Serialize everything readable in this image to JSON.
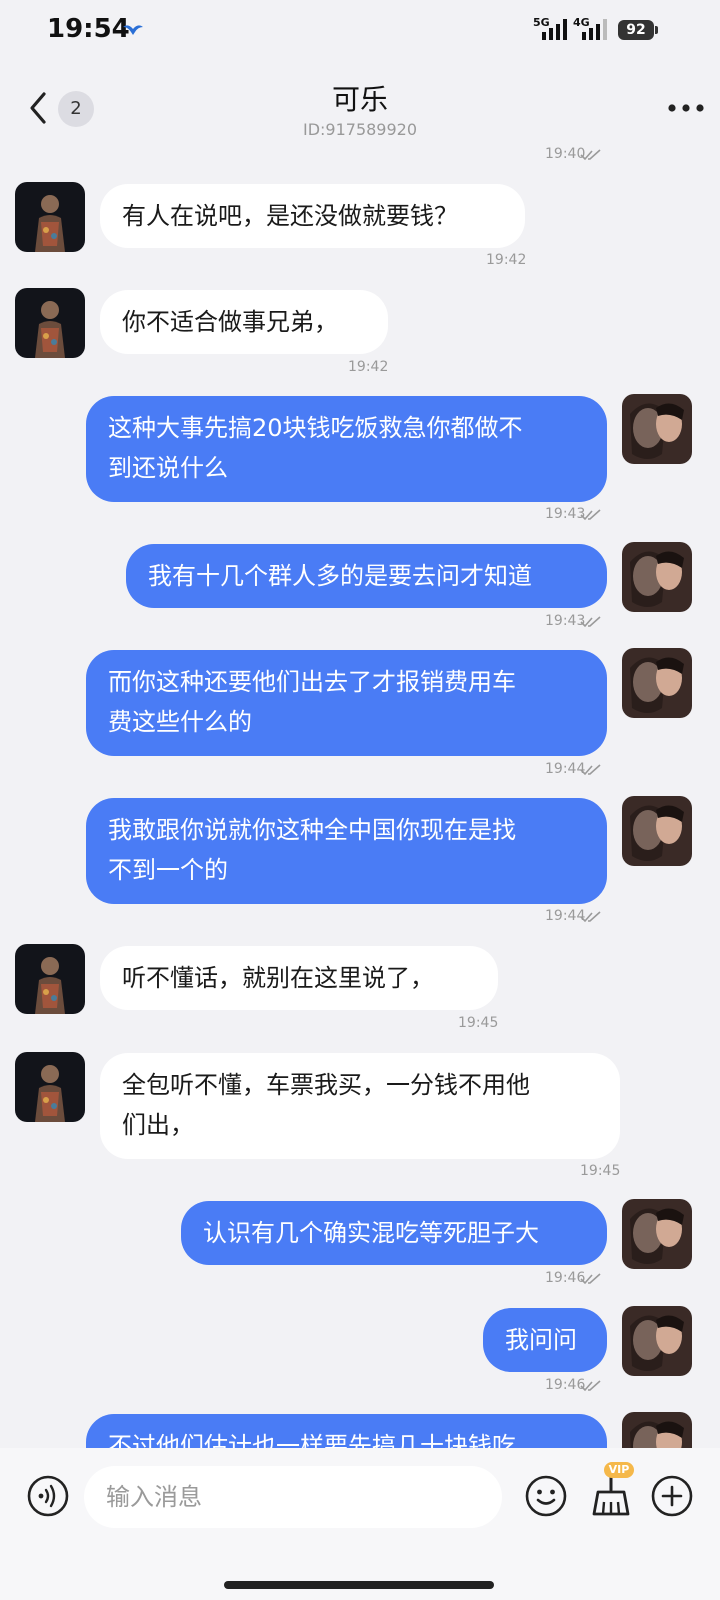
{
  "status_bar": {
    "time": "19:54",
    "network_1": "5G",
    "network_2": "4G",
    "battery": "92"
  },
  "header": {
    "title": "可乐",
    "subtitle": "ID:917589920",
    "unread_count": "2"
  },
  "messages": [
    {
      "side": "out",
      "lines": [],
      "time": "19:40",
      "read": true
    },
    {
      "side": "in",
      "lines": [
        "有人在说吧，是还没做就要钱？"
      ],
      "time": "19:42",
      "read": false
    },
    {
      "side": "in",
      "lines": [
        "你不适合做事兄弟，"
      ],
      "time": "19:42",
      "read": false
    },
    {
      "side": "out",
      "lines": [
        "这种大事先搞20块钱吃饭救急你都做不",
        "到还说什么"
      ],
      "time": "19:43",
      "read": true
    },
    {
      "side": "out",
      "lines": [
        "我有十几个群人多的是要去问才知道"
      ],
      "time": "19:43",
      "read": true
    },
    {
      "side": "out",
      "lines": [
        "而你这种还要他们出去了才报销费用车",
        "费这些什么的"
      ],
      "time": "19:44",
      "read": true
    },
    {
      "side": "out",
      "lines": [
        "我敢跟你说就你这种全中国你现在是找",
        "不到一个的"
      ],
      "time": "19:44",
      "read": true
    },
    {
      "side": "in",
      "lines": [
        "听不懂话，就别在这里说了，"
      ],
      "time": "19:45",
      "read": false
    },
    {
      "side": "in",
      "lines": [
        "全包听不懂，车票我买，一分钱不用他",
        "们出，"
      ],
      "time": "19:45",
      "read": false
    },
    {
      "side": "out",
      "lines": [
        "认识有几个确实混吃等死胆子大"
      ],
      "time": "19:46",
      "read": true
    },
    {
      "side": "out",
      "lines": [
        "我问问"
      ],
      "time": "19:46",
      "read": true
    },
    {
      "side": "out",
      "lines": [
        "不过他们估计也一样要先搞几十块钱吃"
      ],
      "time": "",
      "read": false
    }
  ],
  "input": {
    "placeholder": "输入消息",
    "vip_label": "VIP"
  },
  "colors": {
    "outgoing_bubble": "#4a7cf5",
    "incoming_bubble": "#ffffff",
    "background": "#f2f2f5"
  },
  "icons": [
    "back-icon",
    "more-icon",
    "voice-icon",
    "emoji-icon",
    "clean-icon",
    "plus-icon",
    "read-check-icon"
  ]
}
